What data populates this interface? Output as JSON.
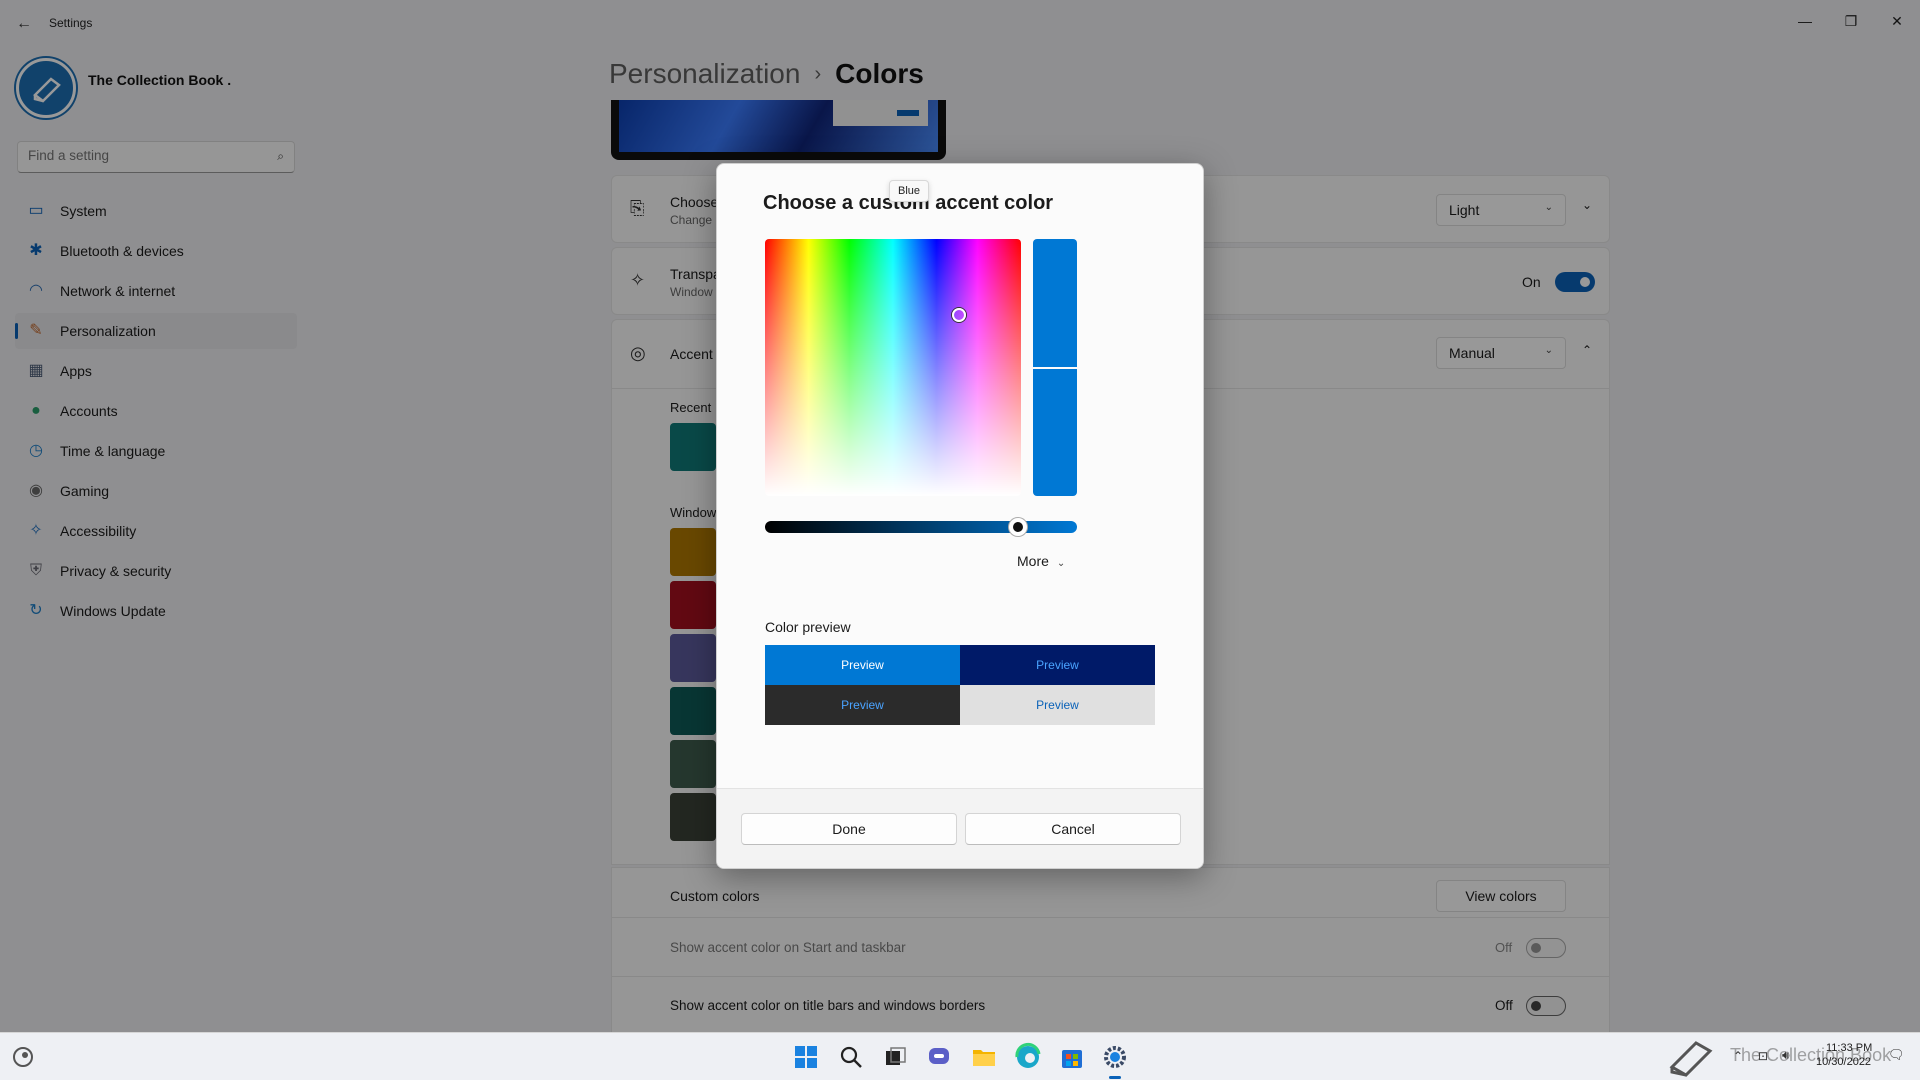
{
  "window": {
    "app_title": "Settings",
    "back_glyph": "←",
    "minimize_glyph": "—",
    "maximize_glyph": "❐",
    "close_glyph": "✕"
  },
  "sidebar": {
    "profile_name": "The Collection Book .",
    "search": {
      "placeholder": "Find a setting",
      "icon": "search-icon"
    },
    "items": [
      {
        "label": "System",
        "icon": "system-icon",
        "color": "#0a62b8"
      },
      {
        "label": "Bluetooth & devices",
        "icon": "bluetooth-icon",
        "color": "#0a62b8"
      },
      {
        "label": "Network & internet",
        "icon": "wifi-icon",
        "color": "#2f6fb5"
      },
      {
        "label": "Personalization",
        "icon": "brush-icon",
        "color": "#c46a2e",
        "active": true
      },
      {
        "label": "Apps",
        "icon": "apps-icon",
        "color": "#4e5e78"
      },
      {
        "label": "Accounts",
        "icon": "accounts-icon",
        "color": "#2a9d6a"
      },
      {
        "label": "Time & language",
        "icon": "clock-globe-icon",
        "color": "#1e7fc9"
      },
      {
        "label": "Gaming",
        "icon": "gamepad-icon",
        "color": "#6a6a6a"
      },
      {
        "label": "Accessibility",
        "icon": "accessibility-icon",
        "color": "#1e6fbf"
      },
      {
        "label": "Privacy & security",
        "icon": "shield-icon",
        "color": "#6a6a74"
      },
      {
        "label": "Windows Update",
        "icon": "update-icon",
        "color": "#1e7fc9"
      }
    ]
  },
  "main": {
    "breadcrumb": {
      "parent": "Personalization",
      "separator": "›",
      "current": "Colors"
    },
    "mode_card": {
      "title": "Choose",
      "subtitle": "Change",
      "value": "Light"
    },
    "transparency_card": {
      "title": "Transpa",
      "subtitle": "Window",
      "state_label": "On"
    },
    "accent_card": {
      "title": "Accent",
      "value": "Manual",
      "recent_label": "Recent",
      "windows_label": "Window"
    },
    "windows_swatches": [
      "#b07800",
      "#a4101f",
      "#5c5a9c",
      "#0e5a57",
      "#3e5c4d",
      "#3b4238"
    ],
    "recent_swatch": "#0f7a78",
    "custom_colors": {
      "label": "Custom colors",
      "button": "View colors"
    },
    "start_taskbar": {
      "label": "Show accent color on Start and taskbar",
      "state_label": "Off"
    },
    "title_bars": {
      "label": "Show accent color on title bars and windows borders",
      "state_label": "Off"
    }
  },
  "dialog": {
    "title": "Choose a custom accent color",
    "tooltip": "Blue",
    "selected_color": "#0078d4",
    "value_level": 0.81,
    "more_label": "More",
    "preview_label": "Color preview",
    "previews": [
      {
        "label": "Preview",
        "bg": "#0078d4",
        "fg": "#ffffff"
      },
      {
        "label": "Preview",
        "bg": "#001a68",
        "fg": "#4aa3ff"
      },
      {
        "label": "Preview",
        "bg": "#2b2b2b",
        "fg": "#4aa3ff"
      },
      {
        "label": "Preview",
        "bg": "#e0e0e0",
        "fg": "#0a62b8"
      }
    ],
    "done_label": "Done",
    "cancel_label": "Cancel"
  },
  "taskbar": {
    "icons": [
      "widgets-icon",
      "start-icon",
      "search-icon",
      "task-view-icon",
      "chat-icon",
      "file-explorer-icon",
      "edge-icon",
      "store-icon",
      "settings-icon"
    ],
    "time": "11:33 PM",
    "date": "10/30/2022",
    "watermark": "The Collection Book"
  }
}
